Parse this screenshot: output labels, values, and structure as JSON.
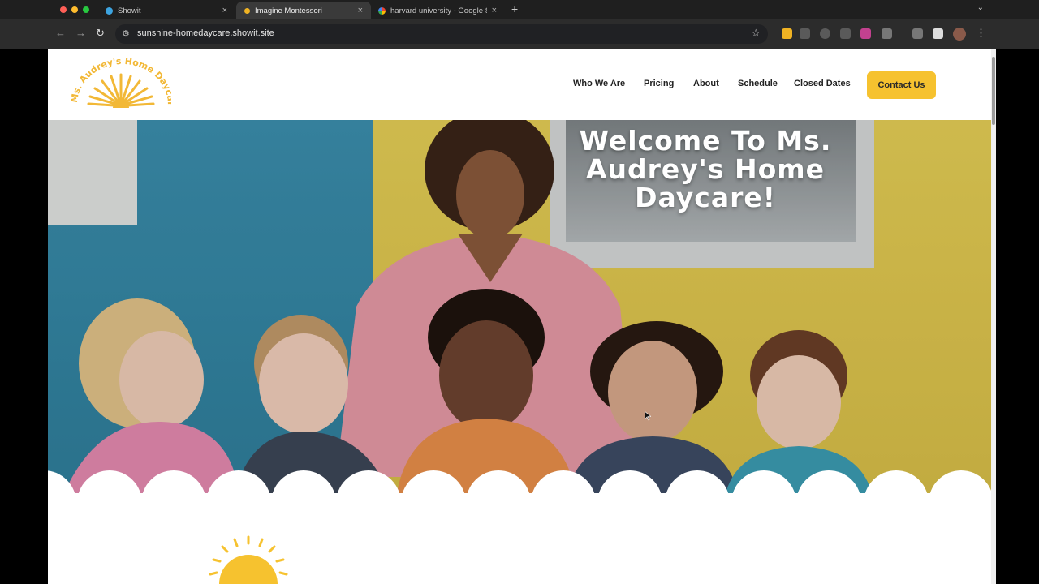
{
  "browser": {
    "tabs": [
      {
        "title": "Showit",
        "favicon": "showit-icon",
        "active": false
      },
      {
        "title": "Imagine Montessori",
        "favicon": "montessori-icon",
        "active": true
      },
      {
        "title": "harvard university - Google S",
        "favicon": "google-icon",
        "active": false
      }
    ],
    "close_glyph": "×",
    "new_tab_glyph": "+",
    "url": "sunshine-homedaycare.showit.site"
  },
  "site": {
    "logo_text": "Ms. Audrey's Home Daycare",
    "nav": [
      "Who We Are",
      "Pricing",
      "About",
      "Schedule",
      "Closed Dates"
    ],
    "cta": "Contact Us",
    "hero_title_lines": [
      "Welcome To Ms.",
      "Audrey's Home",
      "Daycare!"
    ]
  },
  "colors": {
    "accent": "#f6c22f",
    "logo": "#f2b836",
    "text": "#222222"
  }
}
